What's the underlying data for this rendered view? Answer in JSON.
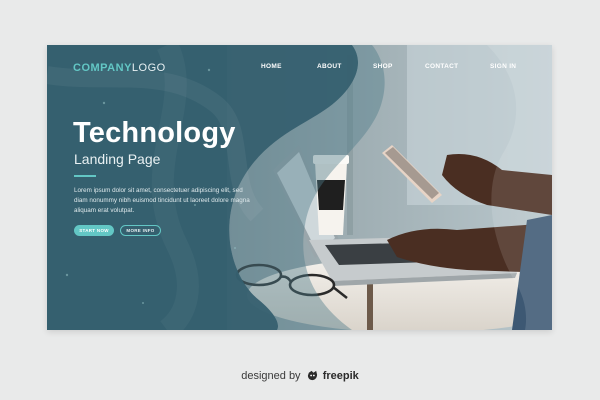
{
  "nav": {
    "logo_bold": "COMPANY",
    "logo_rest": "LOGO",
    "items": [
      "HOME",
      "ABOUT",
      "SHOP",
      "CONTACT",
      "SIGN IN"
    ]
  },
  "hero": {
    "title": "Technology",
    "subtitle": "Landing Page",
    "body": "Lorem ipsum dolor sit amet, consectetuer adipiscing elit, sed diam nonummy nibh euismod tincidunt ut laoreet dolore magna aliquam erat volutpat.",
    "primary_button": "START NOW",
    "secondary_button": "MORE INFO"
  },
  "credit": {
    "prefix": "designed by",
    "brand": "freepik"
  },
  "colors": {
    "panel": "#36606f",
    "accent": "#63c7c5",
    "background": "#e9eaea"
  },
  "icons": [
    "freepik-logo-icon"
  ]
}
